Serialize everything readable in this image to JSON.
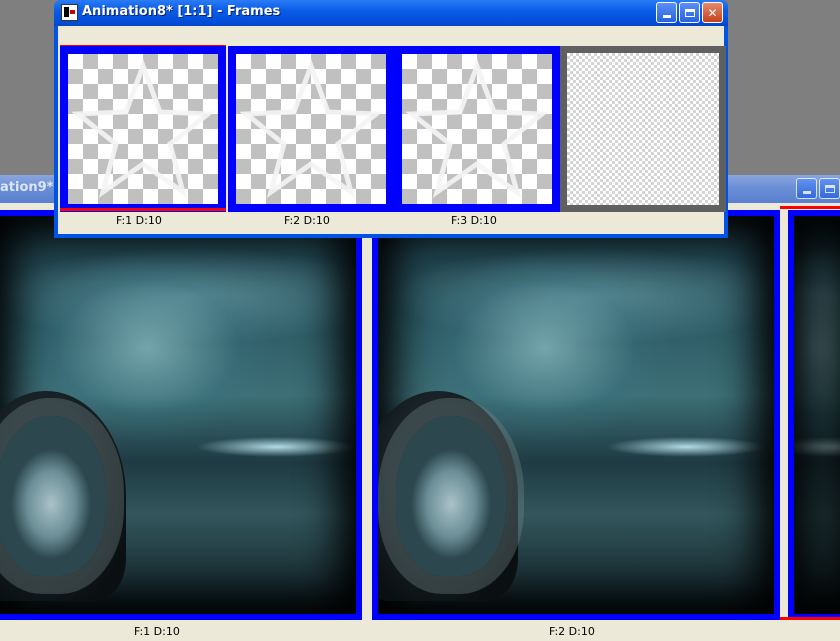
{
  "foreground_window": {
    "title": "Animation8* [1:1] - Frames",
    "app_icon": "animation-shop-icon",
    "controls": [
      "minimize-icon",
      "maximize-icon",
      "close-icon"
    ],
    "frames": [
      {
        "label": "F:1   D:10",
        "selected": true,
        "content": "star-outline-on-transparency"
      },
      {
        "label": "F:2   D:10",
        "selected": true,
        "content": "star-outline-on-transparency"
      },
      {
        "label": "F:3   D:10",
        "selected": true,
        "content": "star-outline-on-transparency"
      },
      {
        "label": "",
        "selected": false,
        "content": "empty-frame"
      }
    ]
  },
  "background_window": {
    "title": "ation9* [",
    "controls": [
      "minimize-icon",
      "maximize-icon"
    ],
    "frames": [
      {
        "label": "F:1   D:10",
        "selected": true,
        "content": "fantasy-woman-moon-image"
      },
      {
        "label": "F:2   D:10",
        "selected": true,
        "content": "fantasy-woman-moon-image"
      }
    ]
  },
  "colors": {
    "selection": "#0000ff",
    "current_frame_marker": "#ff0000",
    "xp_titlebar": "#0a5ce8",
    "client_bg": "#ece9d8"
  }
}
